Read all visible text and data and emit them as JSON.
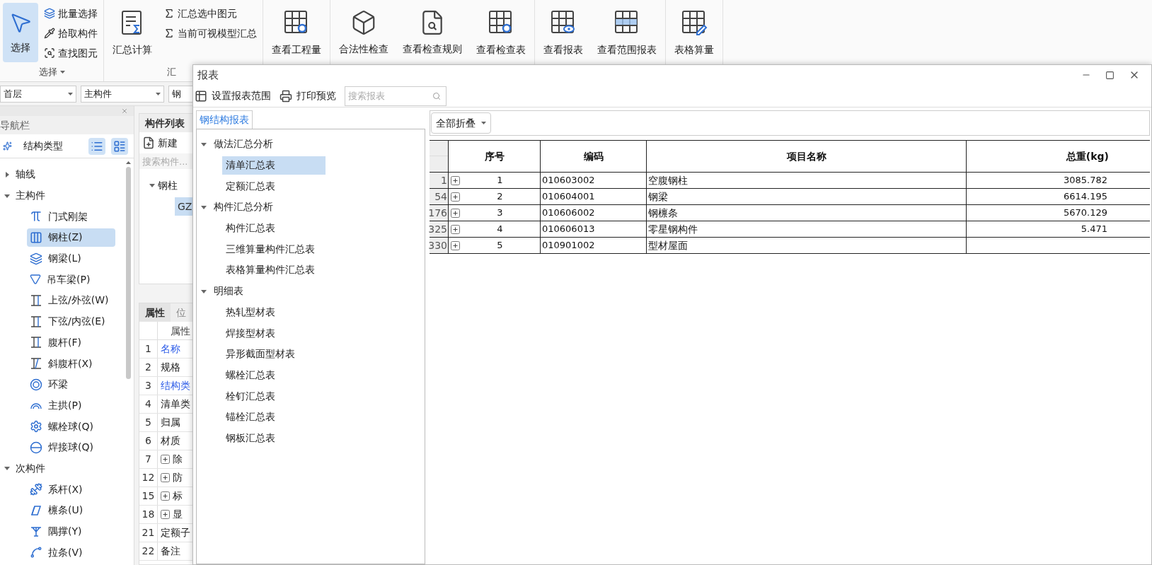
{
  "ribbon": {
    "groups": [
      {
        "label": "选择",
        "menu": true,
        "large": [
          {
            "label": "选择",
            "selected": true
          }
        ],
        "small": [
          {
            "label": "批量选择"
          },
          {
            "label": "拾取构件"
          },
          {
            "label": "查找图元"
          }
        ]
      },
      {
        "label": "汇",
        "menu": false,
        "large": [
          {
            "label": "汇总计算",
            "selected": false
          }
        ],
        "small": [
          {
            "label": "汇总选中图元"
          },
          {
            "label": "当前可视模型汇总"
          }
        ]
      },
      {
        "large": [
          {
            "label": "查看工程量",
            "selected": false
          }
        ]
      },
      {
        "large": [
          {
            "label": "合法性检查",
            "selected": false
          },
          {
            "label": "查看检查规则",
            "selected": false
          },
          {
            "label": "查看检查表",
            "selected": false
          }
        ]
      },
      {
        "large": [
          {
            "label": "查看报表",
            "selected": false
          },
          {
            "label": "查看范围报表",
            "selected": false
          }
        ]
      },
      {
        "large": [
          {
            "label": "表格算量",
            "selected": false
          }
        ]
      }
    ]
  },
  "filters": [
    {
      "value": "首层",
      "caret": true
    },
    {
      "value": "主构件",
      "caret": true
    },
    {
      "value": "钢",
      "caret": false
    }
  ],
  "navigator": {
    "title": "导航栏",
    "mode_label": "结构类型",
    "tree": [
      {
        "label": "轴线",
        "expanded": false
      },
      {
        "label": "主构件",
        "expanded": true,
        "children": [
          {
            "label": "门式刚架",
            "selected": false
          },
          {
            "label": "钢柱(Z)",
            "selected": true
          },
          {
            "label": "钢梁(L)",
            "selected": false
          },
          {
            "label": "吊车梁(P)",
            "selected": false
          },
          {
            "label": "上弦/外弦(W)",
            "selected": false
          },
          {
            "label": "下弦/内弦(E)",
            "selected": false
          },
          {
            "label": "腹杆(F)",
            "selected": false
          },
          {
            "label": "斜腹杆(X)",
            "selected": false
          },
          {
            "label": "环梁",
            "selected": false
          },
          {
            "label": "主拱(P)",
            "selected": false
          },
          {
            "label": "螺栓球(Q)",
            "selected": false
          },
          {
            "label": "焊接球(Q)",
            "selected": false
          }
        ]
      },
      {
        "label": "次构件",
        "expanded": true,
        "children": [
          {
            "label": "系杆(X)",
            "selected": false
          },
          {
            "label": "檩条(U)",
            "selected": false
          },
          {
            "label": "隅撑(Y)",
            "selected": false
          },
          {
            "label": "拉条(V)",
            "selected": false
          }
        ]
      }
    ]
  },
  "component_list": {
    "title": "构件列表",
    "new_button": "新建",
    "search_placeholder": "搜索构件...",
    "tree": [
      {
        "label": "钢柱",
        "expanded": true,
        "children": [
          {
            "label": "GZ",
            "selected": true
          }
        ]
      }
    ]
  },
  "properties": {
    "tabs": [
      {
        "label": "属性",
        "selected": true
      },
      {
        "label": "位",
        "selected": false
      }
    ],
    "column": "属性",
    "rows": [
      {
        "number": "1",
        "name": "名称",
        "linked": true,
        "expandable": false
      },
      {
        "number": "2",
        "name": "规格",
        "linked": false,
        "expandable": false
      },
      {
        "number": "3",
        "name": "结构类",
        "linked": true,
        "expandable": false
      },
      {
        "number": "4",
        "name": "清单类",
        "linked": false,
        "expandable": false
      },
      {
        "number": "5",
        "name": "归属",
        "linked": false,
        "expandable": false
      },
      {
        "number": "6",
        "name": "材质",
        "linked": false,
        "expandable": false
      },
      {
        "number": "7",
        "name": "除",
        "linked": false,
        "expandable": true
      },
      {
        "number": "12",
        "name": "防",
        "linked": false,
        "expandable": true
      },
      {
        "number": "15",
        "name": "标",
        "linked": false,
        "expandable": true
      },
      {
        "number": "18",
        "name": "显",
        "linked": false,
        "expandable": true
      },
      {
        "number": "21",
        "name": "定额子",
        "linked": false,
        "expandable": false
      },
      {
        "number": "22",
        "name": "备注",
        "linked": false,
        "expandable": false
      }
    ]
  },
  "dialog": {
    "title": "报表",
    "toolbar": [
      {
        "label": "设置报表范围"
      },
      {
        "label": "打印预览"
      }
    ],
    "search_placeholder": "搜索报表",
    "tabs": [
      {
        "label": "钢结构报表",
        "selected": true
      }
    ],
    "tree": [
      {
        "label": "做法汇总分析",
        "expanded": true,
        "children": [
          {
            "label": "清单汇总表",
            "selected": true
          },
          {
            "label": "定额汇总表",
            "selected": false
          }
        ]
      },
      {
        "label": "构件汇总分析",
        "expanded": true,
        "children": [
          {
            "label": "构件汇总表",
            "selected": false
          },
          {
            "label": "三维算量构件汇总表",
            "selected": false
          },
          {
            "label": "表格算量构件汇总表",
            "selected": false
          }
        ]
      },
      {
        "label": "明细表",
        "expanded": true,
        "children": [
          {
            "label": "热轧型材表",
            "selected": false
          },
          {
            "label": "焊接型材表",
            "selected": false
          },
          {
            "label": "异形截面型材表",
            "selected": false
          },
          {
            "label": "螺栓汇总表",
            "selected": false
          },
          {
            "label": "栓钉汇总表",
            "selected": false
          },
          {
            "label": "锚栓汇总表",
            "selected": false
          },
          {
            "label": "钢板汇总表",
            "selected": false
          }
        ]
      }
    ],
    "collapse_button": "全部折叠",
    "table": {
      "columns": [
        "序号",
        "编码",
        "项目名称",
        "总重(kg)"
      ],
      "rows": [
        {
          "line": "1",
          "index": "1",
          "code": "010603002",
          "name": "空腹钢柱",
          "weight": "3085.782"
        },
        {
          "line": "54",
          "index": "2",
          "code": "010604001",
          "name": "钢梁",
          "weight": "6614.195"
        },
        {
          "line": "176",
          "index": "3",
          "code": "010606002",
          "name": "钢檩条",
          "weight": "5670.129"
        },
        {
          "line": "325",
          "index": "4",
          "code": "010606013",
          "name": "零星钢构件",
          "weight": "5.471"
        },
        {
          "line": "330",
          "index": "5",
          "code": "010901002",
          "name": "型材屋面"
        }
      ]
    }
  }
}
